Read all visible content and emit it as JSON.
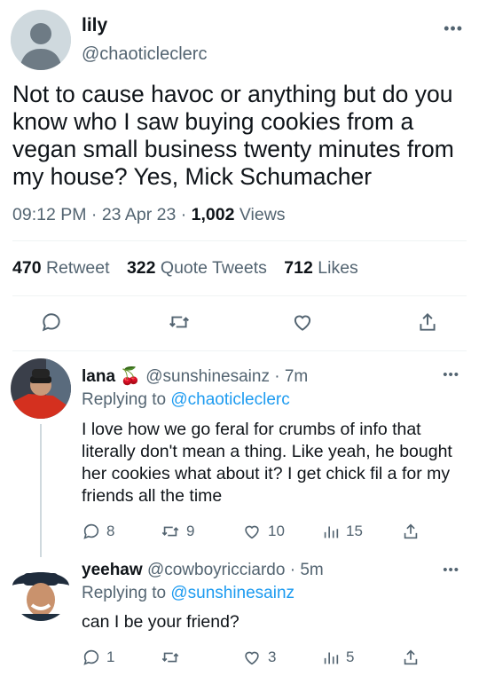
{
  "tweet": {
    "name": "lily",
    "handle": "@chaoticleclerc",
    "text": "Not to cause havoc or anything but do you know who I saw buying cookies from a vegan small business twenty minutes from my house? Yes, Mick Schumacher",
    "time": "09:12 PM",
    "date": "23 Apr 23",
    "views_count": "1,002",
    "views_label": "Views",
    "retweet_count": "470",
    "retweet_label": "Retweet",
    "quote_count": "322",
    "quote_label": "Quote Tweets",
    "likes_count": "712",
    "likes_label": "Likes",
    "more": "•••",
    "icons": [
      "reply-icon",
      "retweet-icon",
      "like-icon",
      "share-icon"
    ]
  },
  "replies": [
    {
      "name": "lana",
      "emoji": "🍒",
      "handle": "@sunshinesainz",
      "time": "7m",
      "replying_label": "Replying to",
      "replying_to": "@chaoticleclerc",
      "text": "I love how we go feral for crumbs of info that literally don't mean a thing. Like yeah, he bought her cookies what about it? I get chick fil a for my friends all the time",
      "replies": "8",
      "retweets": "9",
      "likes": "10",
      "views": "15",
      "more": "•••"
    },
    {
      "name": "yeehaw",
      "handle": "@cowboyricciardo",
      "time": "5m",
      "replying_label": "Replying to",
      "replying_to": "@sunshinesainz",
      "text": "can I be your friend?",
      "replies": "1",
      "retweets": "",
      "likes": "3",
      "views": "5",
      "more": "•••"
    }
  ],
  "colors": {
    "text": "#0f1419",
    "secondary": "#536471",
    "link": "#1d9bf0",
    "divider": "#eff3f4"
  }
}
